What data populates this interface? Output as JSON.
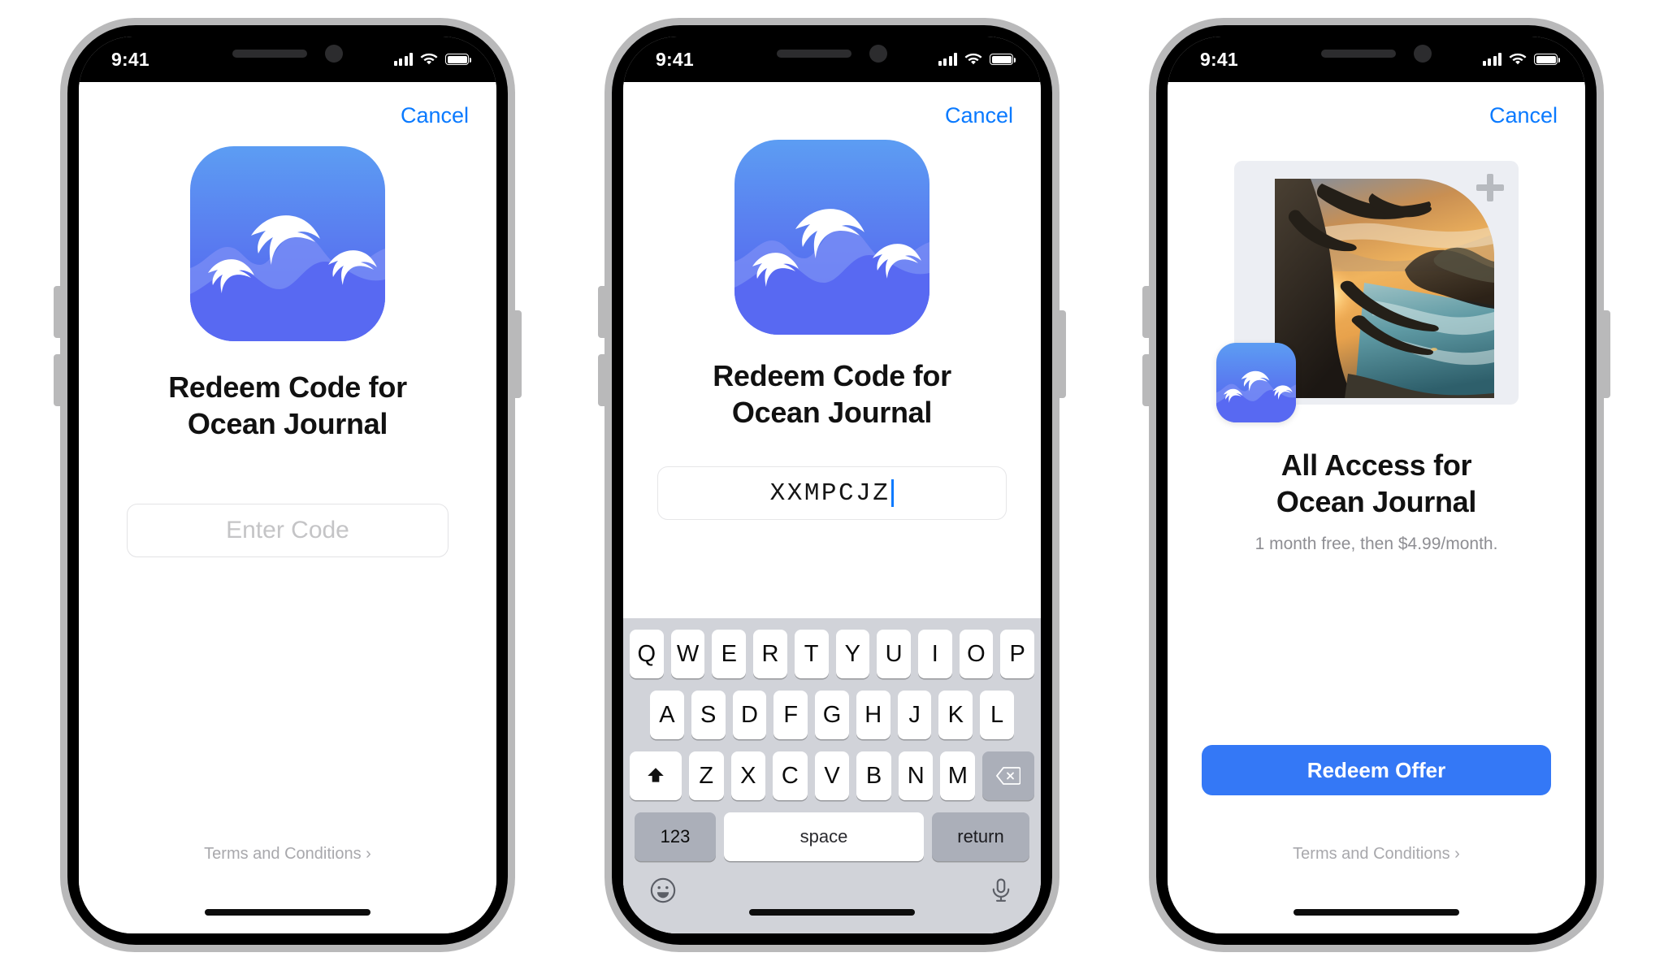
{
  "status_bar": {
    "time": "9:41",
    "cellular_icon": "signal-bars-icon",
    "wifi_icon": "wifi-icon",
    "battery_icon": "battery-icon"
  },
  "accent_colors": {
    "ios_blue": "#0a7aff",
    "button_blue": "#3478f6",
    "icon_gradient_top": "#5c9df3",
    "icon_gradient_bottom": "#4f5df0",
    "keyboard_bg": "#d1d3d9",
    "key_gray": "#abafb9",
    "muted_text": "#8e8e93"
  },
  "phone1": {
    "cancel_label": "Cancel",
    "app_icon_name": "ocean-waves-app-icon",
    "title_line1": "Redeem Code for",
    "title_line2": "Ocean Journal",
    "code_placeholder": "Enter Code",
    "code_value": "",
    "terms_label": "Terms and Conditions ›"
  },
  "phone2": {
    "cancel_label": "Cancel",
    "app_icon_name": "ocean-waves-app-icon",
    "title_line1": "Redeem Code for",
    "title_line2": "Ocean Journal",
    "code_value": "XXMPCJZ",
    "keyboard": {
      "row1": [
        "Q",
        "W",
        "E",
        "R",
        "T",
        "Y",
        "U",
        "I",
        "O",
        "P"
      ],
      "row2": [
        "A",
        "S",
        "D",
        "F",
        "G",
        "H",
        "J",
        "K",
        "L"
      ],
      "row3": [
        "Z",
        "X",
        "C",
        "V",
        "B",
        "N",
        "M"
      ],
      "shift_icon": "shift-arrow-icon",
      "delete_icon": "backspace-icon",
      "numbers_label": "123",
      "space_label": "space",
      "return_label": "return",
      "emoji_icon": "emoji-smiley-icon",
      "mic_icon": "microphone-icon"
    }
  },
  "phone3": {
    "cancel_label": "Cancel",
    "hero_image_name": "coastal-sunset-photo",
    "plus_icon": "plus-icon",
    "badge_icon_name": "ocean-waves-app-icon",
    "title_line1": "All Access for",
    "title_line2": "Ocean Journal",
    "subtitle": "1 month free, then $4.99/month.",
    "cta_label": "Redeem Offer",
    "terms_label": "Terms and Conditions ›"
  }
}
